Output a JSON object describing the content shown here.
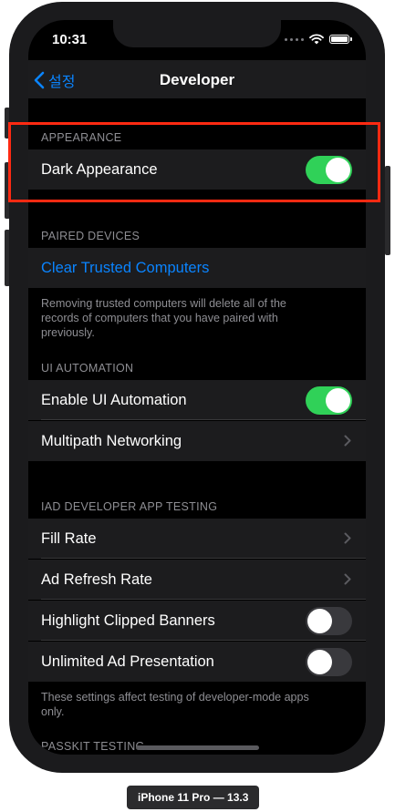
{
  "status_bar": {
    "time": "10:31"
  },
  "nav": {
    "back_label": "설정",
    "title": "Developer"
  },
  "sections": {
    "appearance": {
      "header": "APPEARANCE",
      "dark_appearance": {
        "label": "Dark Appearance",
        "on": true
      }
    },
    "paired_devices": {
      "header": "PAIRED DEVICES",
      "clear_trusted": "Clear Trusted Computers",
      "footer": "Removing trusted computers will delete all of the records of computers that you have paired with previously."
    },
    "ui_automation": {
      "header": "UI AUTOMATION",
      "enable_ui_automation": {
        "label": "Enable UI Automation",
        "on": true
      },
      "multipath_networking": "Multipath Networking"
    },
    "iad": {
      "header": "IAD DEVELOPER APP TESTING",
      "fill_rate": "Fill Rate",
      "ad_refresh_rate": "Ad Refresh Rate",
      "highlight_clipped_banners": {
        "label": "Highlight Clipped Banners",
        "on": false
      },
      "unlimited_ad_presentation": {
        "label": "Unlimited Ad Presentation",
        "on": false
      },
      "footer": "These settings affect testing of developer-mode apps only."
    },
    "passkit": {
      "header": "PASSKIT TESTING"
    }
  },
  "device_caption": "iPhone 11 Pro — 13.3",
  "colors": {
    "accent": "#0a84ff",
    "toggle_on": "#30d158",
    "highlight": "#ff2a12"
  }
}
